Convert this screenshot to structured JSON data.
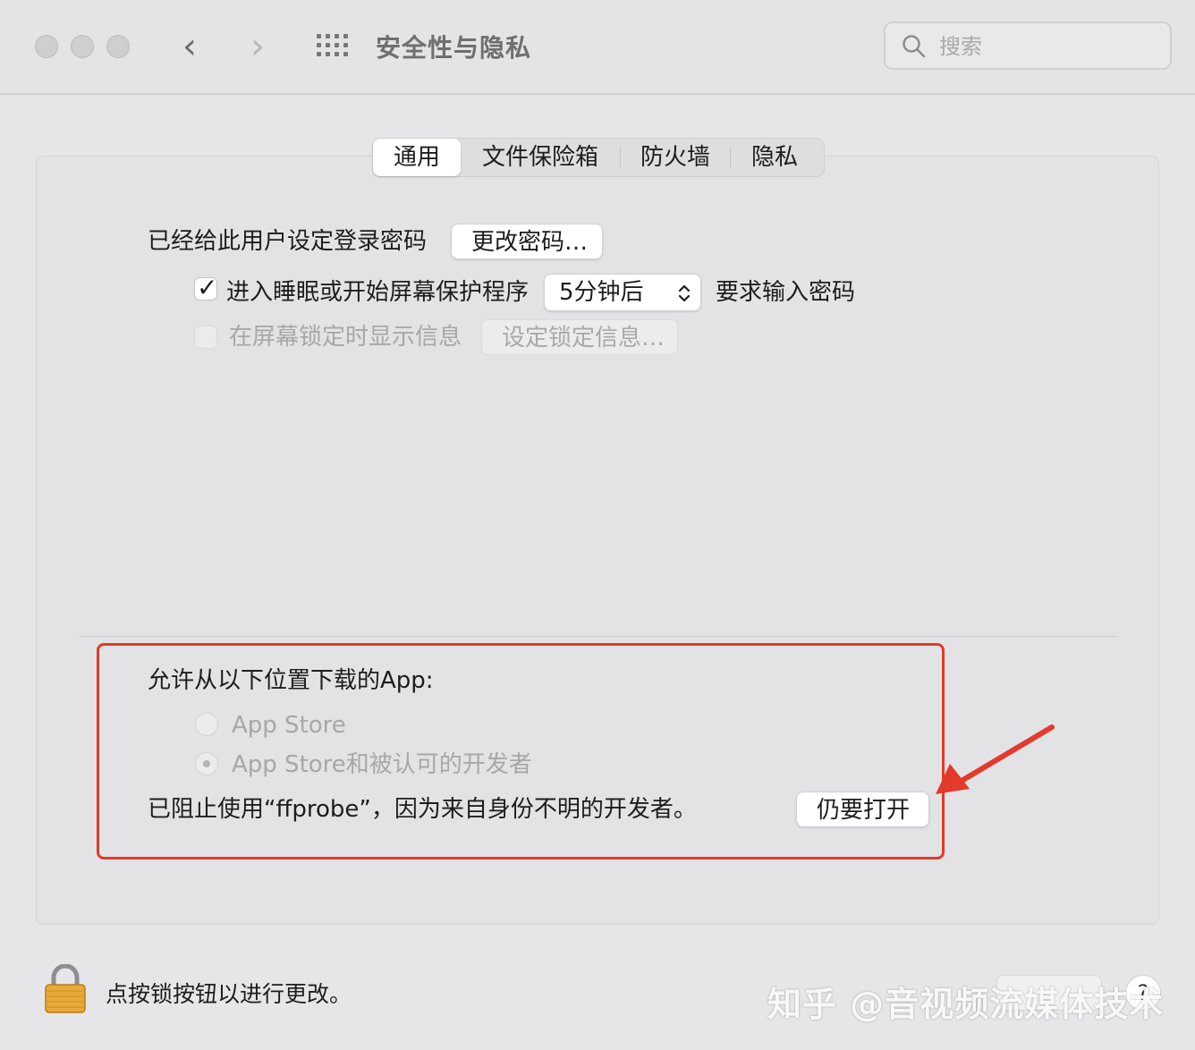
{
  "window": {
    "title": "安全性与隐私",
    "search_placeholder": "搜索"
  },
  "tabs": [
    {
      "label": "通用",
      "active": true
    },
    {
      "label": "文件保险箱",
      "active": false
    },
    {
      "label": "防火墙",
      "active": false
    },
    {
      "label": "隐私",
      "active": false
    }
  ],
  "general": {
    "password_set_label": "已经给此用户设定登录密码",
    "change_password_button": "更改密码…",
    "require_password": {
      "checked": true,
      "label_prefix": "进入睡眠或开始屏幕保护程序",
      "delay_value": "5分钟后",
      "label_suffix": "要求输入密码"
    },
    "lock_message": {
      "checked": false,
      "label": "在屏幕锁定时显示信息",
      "button": "设定锁定信息…"
    }
  },
  "downloads": {
    "heading": "允许从以下位置下载的App:",
    "options": [
      {
        "label": "App Store",
        "selected": false
      },
      {
        "label": "App Store和被认可的开发者",
        "selected": true
      }
    ],
    "blocked_message": "已阻止使用“ffprobe”，因为来自身份不明的开发者。",
    "open_anyway_button": "仍要打开"
  },
  "footer": {
    "lock_text": "点按锁按钮以进行更改。",
    "help_label": "?",
    "watermark": "知乎 @音视频流媒体技术"
  },
  "colors": {
    "highlight": "#e23a2b"
  }
}
